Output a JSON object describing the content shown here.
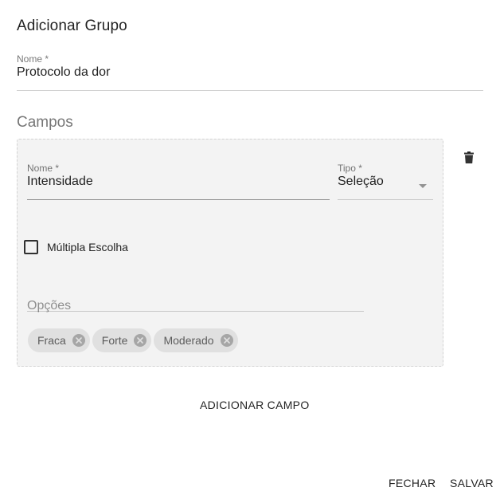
{
  "dialog": {
    "title": "Adicionar Grupo"
  },
  "group_name": {
    "label": "Nome *",
    "value": "Protocolo da dor"
  },
  "fields_section": {
    "title": "Campos",
    "field": {
      "name_label": "Nome *",
      "name_value": "Intensidade",
      "type_label": "Tipo *",
      "type_value": "Seleção",
      "multiple_choice_label": "Múltipla Escolha",
      "multiple_choice_checked": false,
      "options_placeholder": "Opções",
      "options": [
        "Fraca",
        "Forte",
        "Moderado"
      ]
    }
  },
  "actions": {
    "add_field": "ADICIONAR CAMPO",
    "close": "FECHAR",
    "save": "SALVAR"
  },
  "icons": {
    "delete": "trash-icon",
    "chip_remove": "cancel-circle-icon",
    "select": "caret-down-icon"
  }
}
